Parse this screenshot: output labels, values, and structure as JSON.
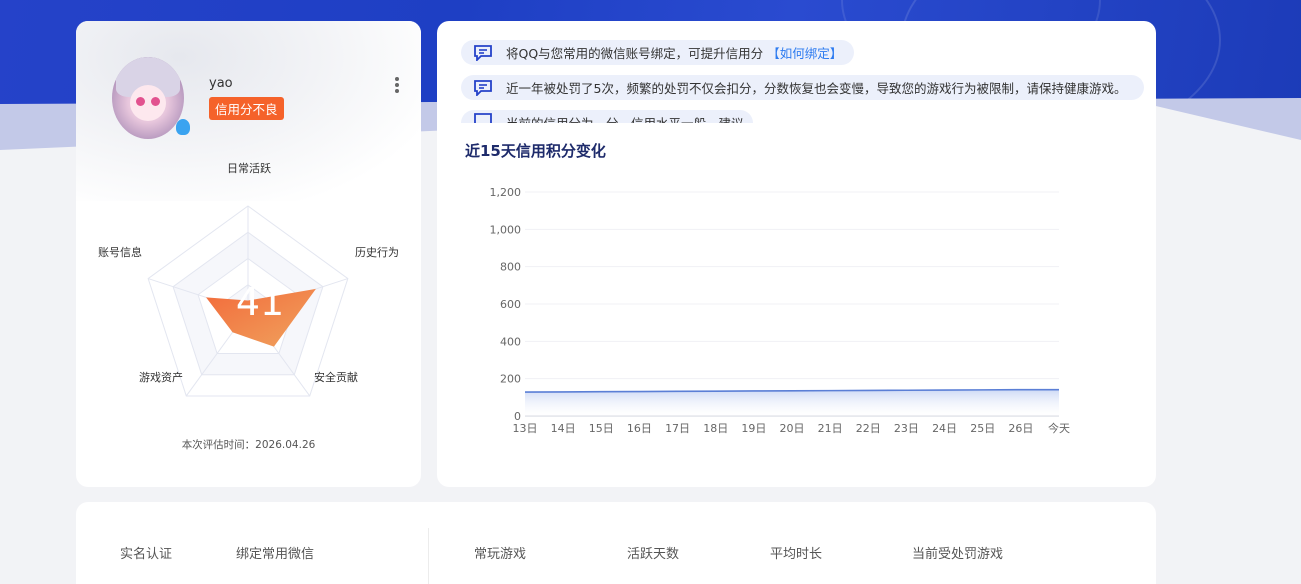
{
  "profile": {
    "username": "yao",
    "credit_tag": "信用分不良",
    "score": "41",
    "radar_labels": {
      "top": "日常活跃",
      "right": "历史行为",
      "bottom_right": "安全贡献",
      "bottom_left": "游戏资产",
      "left": "账号信息"
    },
    "radar_values": [
      0.1,
      0.68,
      0.42,
      0.25,
      0.42
    ],
    "eval_time": "本次评估时间：2026.04.26"
  },
  "notices": [
    {
      "text": "将QQ与您常用的微信账号绑定，可提升信用分",
      "link": "【如何绑定】"
    },
    {
      "text": "近一年被处罚了5次，频繁的处罚不仅会扣分，分数恢复也会变慢，导致您的游戏行为被限制，请保持健康游戏。",
      "link": ""
    },
    {
      "text": "当前的信用分为…分，信用水平一般，建议",
      "link": ""
    }
  ],
  "chart_title": "近15天信用积分变化",
  "chart_data": {
    "type": "area",
    "categories": [
      "13日",
      "14日",
      "15日",
      "16日",
      "17日",
      "18日",
      "19日",
      "20日",
      "21日",
      "22日",
      "23日",
      "24日",
      "25日",
      "26日",
      "今天"
    ],
    "values": [
      128,
      129,
      130,
      131,
      132,
      133,
      134,
      135,
      136,
      137,
      138,
      139,
      140,
      141,
      141
    ],
    "yticks": [
      "0",
      "200",
      "400",
      "600",
      "800",
      "1,000",
      "1,200"
    ],
    "ylim": [
      0,
      1200
    ],
    "line_color": "#5b7fd6",
    "grid": true
  },
  "bottom": {
    "labels": [
      "实名认证",
      "绑定常用微信",
      "常玩游戏",
      "活跃天数",
      "平均时长",
      "当前受处罚游戏"
    ]
  },
  "colors": {
    "brand_blue": "#2542c9",
    "tag_orange": "#f5622a",
    "link_blue": "#2d7bf0"
  }
}
